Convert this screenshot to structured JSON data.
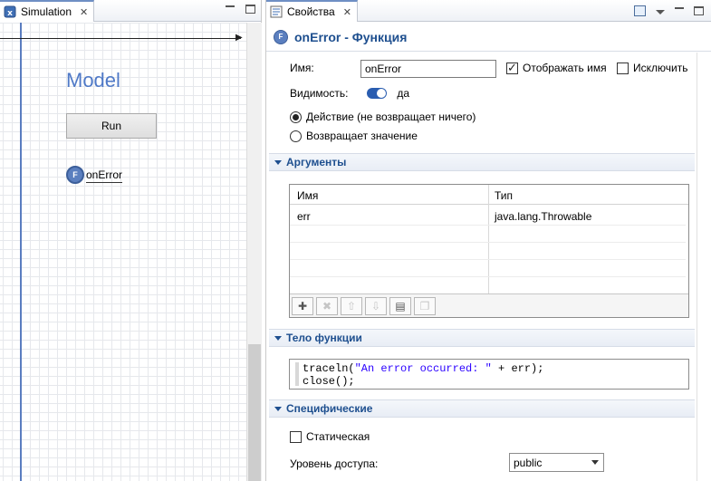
{
  "left_panel": {
    "tab_label": "Simulation",
    "model_title": "Model",
    "run_button": "Run",
    "function_label": "onError"
  },
  "right_panel": {
    "tab_label": "Свойства",
    "header_title": "onError - Функция",
    "name_label": "Имя:",
    "name_value": "onError",
    "show_name_label": "Отображать имя",
    "show_name_checked": true,
    "exclude_label": "Исключить",
    "exclude_checked": false,
    "visibility_label": "Видимость:",
    "visibility_value": "да",
    "radio_action": "Действие (не возвращает ничего)",
    "radio_returns": "Возвращает значение",
    "selected_radio": "action",
    "sections": {
      "arguments": "Аргументы",
      "function_body": "Тело функции",
      "specific": "Специфические"
    },
    "args_table": {
      "columns": [
        "Имя",
        "Тип"
      ],
      "rows": [
        {
          "name": "err",
          "type": "java.lang.Throwable"
        }
      ]
    },
    "code": {
      "line1_prefix": "traceln(",
      "line1_string": "\"An error occurred: \"",
      "line1_suffix": " + err);",
      "line2": "close();"
    },
    "static_label": "Статическая",
    "static_checked": false,
    "access_label": "Уровень доступа:",
    "access_value": "public"
  },
  "icons": {
    "tab_model": "model-icon",
    "function": "function-icon",
    "close": "close-icon",
    "minimize": "minimize-icon",
    "maximize": "maximize-icon"
  },
  "colors": {
    "accent": "#1e4f8f",
    "model_title": "#4f79c7",
    "axis": "#5a7dc0"
  }
}
